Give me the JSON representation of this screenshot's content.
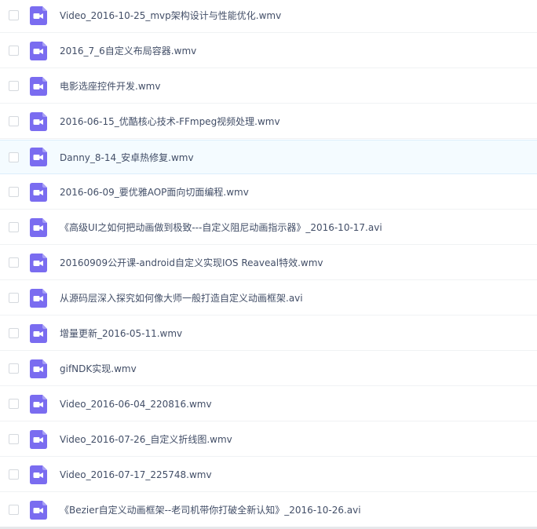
{
  "colors": {
    "icon_purple": "#7a6cf0",
    "icon_fold": "#a79ff5",
    "text": "#424e67",
    "hover_row": "#f4fbff"
  },
  "file_icon": "video-file-icon",
  "files": [
    {
      "name": "Video_2016-10-25_mvp架构设计与性能优化.wmv"
    },
    {
      "name": "2016_7_6自定义布局容器.wmv"
    },
    {
      "name": "电影选座控件开发.wmv"
    },
    {
      "name": "2016-06-15_优酷核心技术-FFmpeg视频处理.wmv"
    },
    {
      "name": "Danny_8-14_安卓热修复.wmv",
      "hovered": true
    },
    {
      "name": "2016-06-09_要优雅AOP面向切面编程.wmv"
    },
    {
      "name": "《高级UI之如何把动画做到极致---自定义阻尼动画指示器》_2016-10-17.avi"
    },
    {
      "name": "20160909公开课-android自定义实现IOS Reaveal特效.wmv"
    },
    {
      "name": "从源码层深入探究如何像大师一般打造自定义动画框架.avi"
    },
    {
      "name": "增量更新_2016-05-11.wmv"
    },
    {
      "name": "gifNDK实现.wmv"
    },
    {
      "name": "Video_2016-06-04_220816.wmv"
    },
    {
      "name": "Video_2016-07-26_自定义折线图.wmv"
    },
    {
      "name": "Video_2016-07-17_225748.wmv"
    },
    {
      "name": "《Bezier自定义动画框架--老司机带你打破全新认知》_2016-10-26.avi"
    }
  ]
}
